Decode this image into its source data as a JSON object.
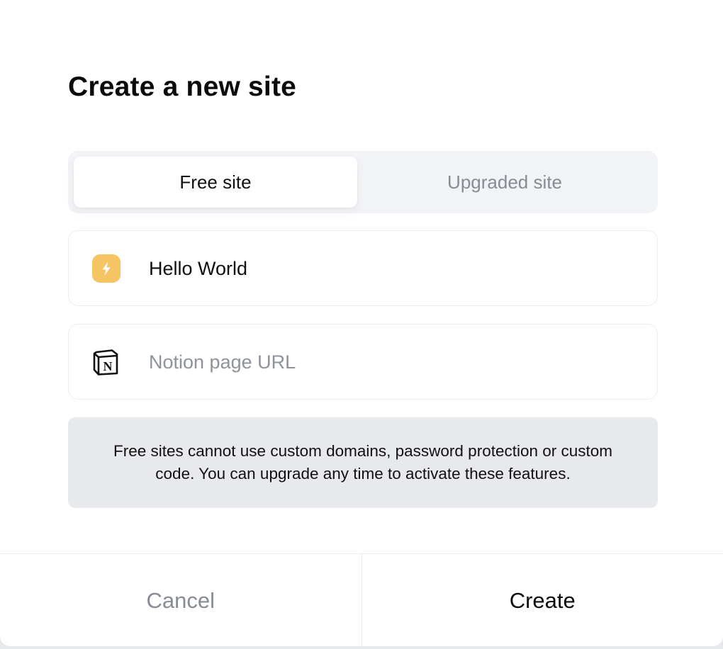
{
  "dialog": {
    "title": "Create a new site"
  },
  "tabs": [
    {
      "label": "Free site",
      "active": true
    },
    {
      "label": "Upgraded site",
      "active": false
    }
  ],
  "site_name": {
    "icon": "lightning-bolt-icon",
    "value": "Hello World"
  },
  "notion_url": {
    "icon": "notion-logo-icon",
    "value": "",
    "placeholder": "Notion page URL"
  },
  "notice": {
    "text": "Free sites cannot use custom domains, password protection or custom code. You can upgrade any time to activate these features."
  },
  "footer": {
    "cancel_label": "Cancel",
    "create_label": "Create"
  },
  "colors": {
    "accent_icon": "#f7c464",
    "muted_text": "#878b93",
    "notice_bg": "#e8e9ec",
    "tab_track_bg": "#f2f3f6"
  }
}
